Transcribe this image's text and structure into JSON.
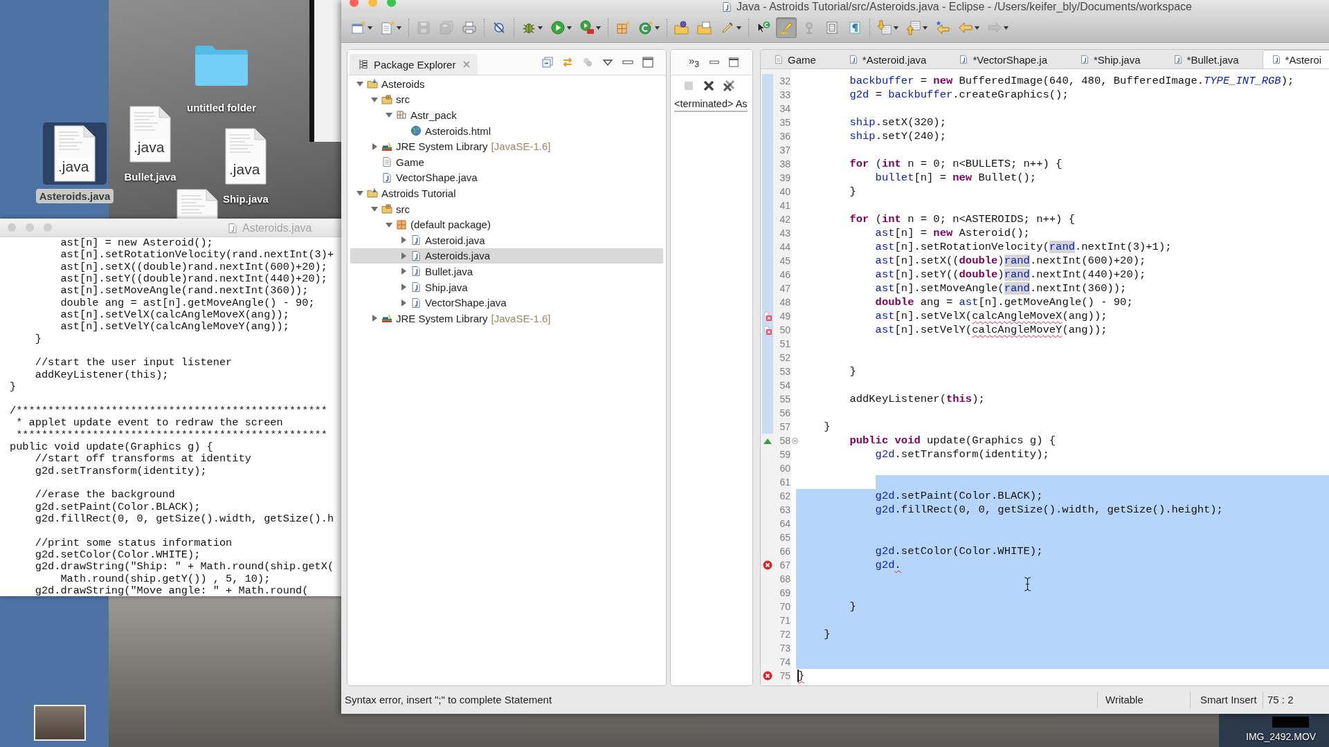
{
  "desktop": {
    "icons": [
      {
        "kind": "folder",
        "label": "untitled folder",
        "selected": false
      },
      {
        "kind": "java-file",
        "badge": ".java",
        "label": "Asteroids.java",
        "selected": true
      },
      {
        "kind": "java-file",
        "badge": ".java",
        "label": "Bullet.java",
        "selected": false
      },
      {
        "kind": "java-file",
        "badge": ".java",
        "label": "Ship.java",
        "selected": false
      },
      {
        "kind": "document",
        "selected": false
      }
    ],
    "video_file": {
      "label": "IMG_2492.MOV"
    }
  },
  "text_window": {
    "title": "Asteroids.java",
    "active": false,
    "blocks": [
      [
        "        ast[n] = new Asteroid();",
        "        ast[n].setRotationVelocity(rand.nextInt(3)+",
        "        ast[n].setX((double)rand.nextInt(600)+20);",
        "        ast[n].setY((double)rand.nextInt(440)+20);",
        "        ast[n].setMoveAngle(rand.nextInt(360));",
        "        double ang = ast[n].getMoveAngle() - 90;",
        "        ast[n].setVelX(calcAngleMoveX(ang));",
        "        ast[n].setVelY(calcAngleMoveY(ang));",
        "    }"
      ],
      [
        "    //start the user input listener",
        "    addKeyListener(this);",
        "}"
      ],
      [
        "/*************************************************",
        " * applet update event to redraw the screen",
        " *************************************************",
        "public void update(Graphics g) {",
        "    //start off transforms at identity",
        "    g2d.setTransform(identity);"
      ],
      [
        "    //erase the background",
        "    g2d.setPaint(Color.BLACK);",
        "    g2d.fillRect(0, 0, getSize().width, getSize().h"
      ],
      [
        "    //print some status information",
        "    g2d.setColor(Color.WHITE);",
        "    g2d.drawString(\"Ship: \" + Math.round(ship.getX(",
        "        Math.round(ship.getY()) , 5, 10);",
        "    g2d.drawString(\"Move angle: \" + Math.round("
      ]
    ]
  },
  "eclipse": {
    "title": "Java - Astroids Tutorial/src/Asteroids.java - Eclipse - /Users/keifer_bly/Documents/workspace",
    "active": true,
    "toolbar": [
      [
        {
          "kind": "new-wizard",
          "menu": true,
          "pressed": false,
          "disabled": false
        },
        {
          "kind": "new-file",
          "menu": true,
          "pressed": false,
          "disabled": false
        }
      ],
      [
        {
          "kind": "save",
          "menu": false,
          "pressed": false,
          "disabled": true
        },
        {
          "kind": "save-all",
          "menu": false,
          "pressed": false,
          "disabled": true
        },
        {
          "kind": "print",
          "menu": false,
          "pressed": false,
          "disabled": false
        }
      ],
      [
        {
          "kind": "skip-breakpoints",
          "menu": false,
          "pressed": false,
          "disabled": false
        }
      ],
      [
        {
          "kind": "debug",
          "menu": true,
          "pressed": false,
          "disabled": false
        },
        {
          "kind": "run",
          "menu": true,
          "pressed": false,
          "disabled": false
        },
        {
          "kind": "coverage",
          "menu": true,
          "pressed": false,
          "disabled": false
        }
      ],
      [
        {
          "kind": "new-package",
          "menu": false,
          "pressed": false,
          "disabled": false
        },
        {
          "kind": "new-class",
          "menu": true,
          "pressed": false,
          "disabled": false
        }
      ],
      [
        {
          "kind": "open-type",
          "menu": false,
          "pressed": false,
          "disabled": false
        },
        {
          "kind": "open-task",
          "menu": false,
          "pressed": false,
          "disabled": false
        },
        {
          "kind": "search",
          "menu": true,
          "pressed": false,
          "disabled": false
        }
      ],
      [
        {
          "kind": "pointer-class",
          "menu": false,
          "pressed": false,
          "disabled": false
        },
        {
          "kind": "mark-occurrences",
          "menu": false,
          "pressed": true,
          "disabled": false
        },
        {
          "kind": "ring-tool",
          "menu": false,
          "pressed": false,
          "disabled": true
        },
        {
          "kind": "block-selection",
          "menu": false,
          "pressed": false,
          "disabled": false
        },
        {
          "kind": "show-whitespace",
          "menu": false,
          "pressed": false,
          "disabled": false
        }
      ],
      [
        {
          "kind": "next-annotation",
          "menu": true,
          "pressed": false,
          "disabled": false
        },
        {
          "kind": "previous-annotation",
          "menu": true,
          "pressed": false,
          "disabled": false
        },
        {
          "kind": "last-edit",
          "menu": false,
          "pressed": false,
          "disabled": false
        },
        {
          "kind": "back",
          "menu": true,
          "pressed": false,
          "disabled": false
        },
        {
          "kind": "forward",
          "menu": true,
          "pressed": false,
          "disabled": true
        }
      ]
    ],
    "package_explorer": {
      "title": "Package Explorer",
      "tree": [
        {
          "label": "Asteroids",
          "kind": "project",
          "expanded": true,
          "selected": false,
          "children": [
            {
              "label": "src",
              "kind": "source-folder",
              "expanded": true,
              "selected": false,
              "children": [
                {
                  "label": "Astr_pack",
                  "kind": "package",
                  "expanded": true,
                  "selected": false,
                  "children": [
                    {
                      "label": "Asteroids.html",
                      "kind": "html-file",
                      "selected": false
                    }
                  ]
                }
              ]
            },
            {
              "label": "JRE System Library",
              "decoration": "[JavaSE-1.6]",
              "kind": "library",
              "expanded": false,
              "selected": false
            },
            {
              "label": "Game",
              "kind": "text-file",
              "selected": false
            },
            {
              "label": "VectorShape.java",
              "kind": "java-file",
              "selected": false
            }
          ]
        },
        {
          "label": "Astroids Tutorial",
          "kind": "project",
          "expanded": true,
          "selected": false,
          "children": [
            {
              "label": "src",
              "kind": "source-folder",
              "expanded": true,
              "selected": false,
              "children": [
                {
                  "label": "(default package)",
                  "kind": "default-package",
                  "expanded": true,
                  "selected": false,
                  "children": [
                    {
                      "label": "Asteroid.java",
                      "kind": "java-file",
                      "expanded": false,
                      "selected": false
                    },
                    {
                      "label": "Asteroids.java",
                      "kind": "java-file",
                      "expanded": false,
                      "selected": true
                    },
                    {
                      "label": "Bullet.java",
                      "kind": "java-file",
                      "expanded": false,
                      "selected": false
                    },
                    {
                      "label": "Ship.java",
                      "kind": "java-file",
                      "expanded": false,
                      "selected": false
                    },
                    {
                      "label": "VectorShape.java",
                      "kind": "java-file",
                      "expanded": false,
                      "selected": false
                    }
                  ]
                }
              ]
            },
            {
              "label": "JRE System Library",
              "decoration": "[JavaSE-1.6]",
              "kind": "library",
              "expanded": false,
              "selected": false
            }
          ]
        }
      ]
    },
    "console": {
      "views_overflow": "»$_{3}$",
      "launch": "<terminated> As"
    },
    "editor": {
      "tabs": [
        {
          "label": "Game",
          "kind": "text-file",
          "selected": false
        },
        {
          "label": "*Asteroid.java",
          "kind": "java-file",
          "selected": false
        },
        {
          "label": "*VectorShape.ja",
          "kind": "java-file",
          "selected": false
        },
        {
          "label": "*Ship.java",
          "kind": "java-file",
          "selected": false
        },
        {
          "label": "*Bullet.java",
          "kind": "java-file",
          "selected": false
        },
        {
          "label": "*Asteroi",
          "kind": "java-file",
          "selected": true
        }
      ],
      "lines": [
        {
          "number": "32",
          "changed": true,
          "selected": false,
          "code": [
            {
              "kind": "field",
              "text": "        backbuffer"
            },
            {
              "kind": "text",
              "text": " = "
            },
            {
              "kind": "kw",
              "text": "new"
            },
            {
              "kind": "text",
              "text": " BufferedImage(640, 480, BufferedImage."
            },
            {
              "kind": "const",
              "text": "TYPE_INT_RGB"
            },
            {
              "kind": "text",
              "text": ");"
            }
          ]
        },
        {
          "number": "33",
          "changed": true,
          "selected": false,
          "code": [
            {
              "kind": "field",
              "text": "        g2d"
            },
            {
              "kind": "text",
              "text": " = "
            },
            {
              "kind": "field",
              "text": "backbuffer"
            },
            {
              "kind": "text",
              "text": ".createGraphics();"
            }
          ]
        },
        {
          "number": "34",
          "changed": true,
          "selected": false
        },
        {
          "number": "35",
          "changed": true,
          "selected": false,
          "code": [
            {
              "kind": "field",
              "text": "        ship"
            },
            {
              "kind": "text",
              "text": ".setX(320);"
            }
          ]
        },
        {
          "number": "36",
          "changed": true,
          "selected": false,
          "code": [
            {
              "kind": "field",
              "text": "        ship"
            },
            {
              "kind": "text",
              "text": ".setY(240);"
            }
          ]
        },
        {
          "number": "37",
          "changed": true,
          "selected": false
        },
        {
          "number": "38",
          "changed": true,
          "selected": false,
          "code": [
            {
              "kind": "kw",
              "text": "        for"
            },
            {
              "kind": "text",
              "text": " ("
            },
            {
              "kind": "kw",
              "text": "int"
            },
            {
              "kind": "text",
              "text": " n = 0; n<BULLETS; n++) {"
            }
          ]
        },
        {
          "number": "39",
          "changed": true,
          "selected": false,
          "code": [
            {
              "kind": "field",
              "text": "            bullet"
            },
            {
              "kind": "text",
              "text": "[n] = "
            },
            {
              "kind": "kw",
              "text": "new"
            },
            {
              "kind": "text",
              "text": " Bullet();"
            }
          ]
        },
        {
          "number": "40",
          "changed": true,
          "selected": false,
          "code": [
            {
              "kind": "text",
              "text": "        }"
            }
          ]
        },
        {
          "number": "41",
          "changed": true,
          "selected": false
        },
        {
          "number": "42",
          "changed": true,
          "selected": false,
          "code": [
            {
              "kind": "kw",
              "text": "        for"
            },
            {
              "kind": "text",
              "text": " ("
            },
            {
              "kind": "kw",
              "text": "int"
            },
            {
              "kind": "text",
              "text": " n = 0; n<ASTEROIDS; n++) {"
            }
          ]
        },
        {
          "number": "43",
          "changed": true,
          "selected": false,
          "code": [
            {
              "kind": "field",
              "text": "            ast"
            },
            {
              "kind": "text",
              "text": "[n] = "
            },
            {
              "kind": "kw",
              "text": "new"
            },
            {
              "kind": "text",
              "text": " Asteroid();"
            }
          ]
        },
        {
          "number": "44",
          "changed": true,
          "selected": false,
          "code": [
            {
              "kind": "field",
              "text": "            ast"
            },
            {
              "kind": "text",
              "text": "[n].setRotationVelocity("
            },
            {
              "kind": "mark",
              "text": "rand"
            },
            {
              "kind": "text",
              "text": ".nextInt(3)+1);"
            }
          ]
        },
        {
          "number": "45",
          "changed": true,
          "selected": false,
          "code": [
            {
              "kind": "field",
              "text": "            ast"
            },
            {
              "kind": "text",
              "text": "[n].setX(("
            },
            {
              "kind": "kw",
              "text": "double"
            },
            {
              "kind": "text",
              "text": ")"
            },
            {
              "kind": "mark",
              "text": "rand"
            },
            {
              "kind": "text",
              "text": ".nextInt(600)+20);"
            }
          ]
        },
        {
          "number": "46",
          "changed": true,
          "selected": false,
          "code": [
            {
              "kind": "field",
              "text": "            ast"
            },
            {
              "kind": "text",
              "text": "[n].setY(("
            },
            {
              "kind": "kw",
              "text": "double"
            },
            {
              "kind": "text",
              "text": ")"
            },
            {
              "kind": "mark",
              "text": "rand"
            },
            {
              "kind": "text",
              "text": ".nextInt(440)+20);"
            }
          ]
        },
        {
          "number": "47",
          "changed": true,
          "selected": false,
          "code": [
            {
              "kind": "field",
              "text": "            ast"
            },
            {
              "kind": "text",
              "text": "[n].setMoveAngle("
            },
            {
              "kind": "mark",
              "text": "rand"
            },
            {
              "kind": "text",
              "text": ".nextInt(360));"
            }
          ]
        },
        {
          "number": "48",
          "changed": true,
          "selected": false,
          "code": [
            {
              "kind": "kw",
              "text": "            double"
            },
            {
              "kind": "text",
              "text": " ang = "
            },
            {
              "kind": "field",
              "text": "ast"
            },
            {
              "kind": "text",
              "text": "[n].getMoveAngle() - 90;"
            }
          ]
        },
        {
          "number": "49",
          "changed": true,
          "selected": false,
          "marker": {
            "kind": "quickfix"
          },
          "code": [
            {
              "kind": "field",
              "text": "            ast"
            },
            {
              "kind": "text",
              "text": "[n].setVelX("
            },
            {
              "kind": "err",
              "text": "calcAngleMoveX"
            },
            {
              "kind": "text",
              "text": "(ang));"
            }
          ]
        },
        {
          "number": "50",
          "changed": true,
          "selected": false,
          "marker": {
            "kind": "quickfix"
          },
          "code": [
            {
              "kind": "field",
              "text": "            ast"
            },
            {
              "kind": "text",
              "text": "[n].setVelY("
            },
            {
              "kind": "err",
              "text": "calcAngleMoveY"
            },
            {
              "kind": "text",
              "text": "(ang));"
            }
          ]
        },
        {
          "number": "51",
          "changed": true,
          "selected": false
        },
        {
          "number": "52",
          "changed": true,
          "selected": false
        },
        {
          "number": "53",
          "changed": true,
          "selected": false,
          "code": [
            {
              "kind": "text",
              "text": "        }"
            }
          ]
        },
        {
          "number": "54",
          "changed": true,
          "selected": false
        },
        {
          "number": "55",
          "changed": true,
          "selected": false,
          "code": [
            {
              "kind": "text",
              "text": "        addKeyListener("
            },
            {
              "kind": "kw",
              "text": "this"
            },
            {
              "kind": "text",
              "text": ");"
            }
          ]
        },
        {
          "number": "56",
          "changed": true,
          "selected": false
        },
        {
          "number": "57",
          "changed": true,
          "selected": false,
          "code": [
            {
              "kind": "text",
              "text": "    }"
            }
          ]
        },
        {
          "number": "58",
          "changed": false,
          "selected": false,
          "marker": {
            "kind": "override"
          },
          "fold": true,
          "code": [
            {
              "kind": "kw",
              "text": "        public void"
            },
            {
              "kind": "text",
              "text": " update(Graphics g) {"
            }
          ]
        },
        {
          "number": "59",
          "changed": false,
          "selected": false,
          "code": [
            {
              "kind": "field",
              "text": "            g2d"
            },
            {
              "kind": "text",
              "text": ".setTransform(identity);"
            }
          ]
        },
        {
          "number": "60",
          "changed": false,
          "selected": false
        },
        {
          "number": "61",
          "changed": false,
          "selected": true,
          "selection_start": {
            "kind": "indent"
          }
        },
        {
          "number": "62",
          "changed": false,
          "selected": true,
          "code": [
            {
              "kind": "field",
              "text": "            g2d"
            },
            {
              "kind": "text",
              "text": ".setPaint(Color.BLACK);"
            }
          ]
        },
        {
          "number": "63",
          "changed": false,
          "selected": true,
          "code": [
            {
              "kind": "field",
              "text": "            g2d"
            },
            {
              "kind": "text",
              "text": ".fillRect(0, 0, getSize().width, getSize().height);"
            }
          ]
        },
        {
          "number": "64",
          "changed": false,
          "selected": true
        },
        {
          "number": "65",
          "changed": false,
          "selected": true
        },
        {
          "number": "66",
          "changed": false,
          "selected": true,
          "code": [
            {
              "kind": "field",
              "text": "            g2d"
            },
            {
              "kind": "text",
              "text": ".setColor(Color.WHITE);"
            }
          ]
        },
        {
          "number": "67",
          "changed": false,
          "selected": true,
          "marker": {
            "kind": "error"
          },
          "code": [
            {
              "kind": "field",
              "text": "            g2d"
            },
            {
              "kind": "err",
              "text": "."
            }
          ]
        },
        {
          "number": "68",
          "changed": false,
          "selected": true
        },
        {
          "number": "69",
          "changed": false,
          "selected": true
        },
        {
          "number": "70",
          "changed": false,
          "selected": true,
          "code": [
            {
              "kind": "text",
              "text": "        }"
            }
          ]
        },
        {
          "number": "71",
          "changed": false,
          "selected": true
        },
        {
          "number": "72",
          "changed": false,
          "selected": true,
          "code": [
            {
              "kind": "text",
              "text": "    }"
            }
          ]
        },
        {
          "number": "73",
          "changed": false,
          "selected": true
        },
        {
          "number": "74",
          "changed": false,
          "selected": true
        },
        {
          "number": "75",
          "changed": false,
          "selected": false,
          "marker": {
            "kind": "error"
          },
          "caret": true,
          "code": [
            {
              "kind": "err",
              "text": "}"
            }
          ]
        }
      ]
    },
    "status_bar": {
      "message": "Syntax error, insert \";\" to complete Statement",
      "write_mode": "Writable",
      "insert_mode": "Smart Insert",
      "position": "75 : 2"
    }
  }
}
